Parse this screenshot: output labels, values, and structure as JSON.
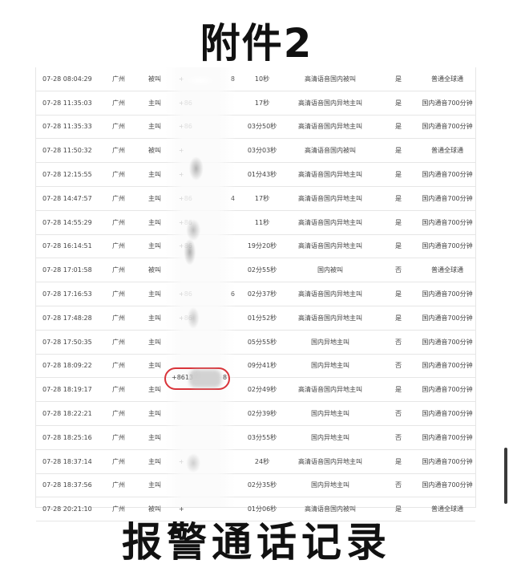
{
  "top_title": "附件2",
  "bottom_title": "报警通话记录",
  "records": [
    {
      "time": "07-28 08:04:29",
      "city": "广州",
      "direction": "被叫",
      "number": "+",
      "tail": "8",
      "duration": "10秒",
      "call_type": "高清语音国内被叫",
      "roaming": "是",
      "package": "普通全球通"
    },
    {
      "time": "07-28 11:35:03",
      "city": "广州",
      "direction": "主叫",
      "number": "+86",
      "tail": "",
      "duration": "17秒",
      "call_type": "高清语音国内异地主叫",
      "roaming": "是",
      "package": "国内通音700分钟"
    },
    {
      "time": "07-28 11:35:33",
      "city": "广州",
      "direction": "主叫",
      "number": "+86",
      "tail": "",
      "duration": "03分50秒",
      "call_type": "高清语音国内异地主叫",
      "roaming": "是",
      "package": "国内通音700分钟"
    },
    {
      "time": "07-28 11:50:32",
      "city": "广州",
      "direction": "被叫",
      "number": "+",
      "tail": "",
      "duration": "03分03秒",
      "call_type": "高清语音国内被叫",
      "roaming": "是",
      "package": "普通全球通"
    },
    {
      "time": "07-28 12:15:55",
      "city": "广州",
      "direction": "主叫",
      "number": "+",
      "tail": "",
      "duration": "01分43秒",
      "call_type": "高清语音国内异地主叫",
      "roaming": "是",
      "package": "国内通音700分钟"
    },
    {
      "time": "07-28 14:47:57",
      "city": "广州",
      "direction": "主叫",
      "number": "+86",
      "tail": "4",
      "duration": "17秒",
      "call_type": "高清语音国内异地主叫",
      "roaming": "是",
      "package": "国内通音700分钟"
    },
    {
      "time": "07-28 14:55:29",
      "city": "广州",
      "direction": "主叫",
      "number": "+86",
      "tail": "",
      "duration": "11秒",
      "call_type": "高清语音国内异地主叫",
      "roaming": "是",
      "package": "国内通音700分钟"
    },
    {
      "time": "07-28 16:14:51",
      "city": "广州",
      "direction": "主叫",
      "number": "+86",
      "tail": "",
      "duration": "19分20秒",
      "call_type": "高清语音国内异地主叫",
      "roaming": "是",
      "package": "国内通音700分钟"
    },
    {
      "time": "07-28 17:01:58",
      "city": "广州",
      "direction": "被叫",
      "number": "",
      "tail": "",
      "duration": "02分55秒",
      "call_type": "国内被叫",
      "roaming": "否",
      "package": "普通全球通"
    },
    {
      "time": "07-28 17:16:53",
      "city": "广州",
      "direction": "主叫",
      "number": "+86",
      "tail": "6",
      "duration": "02分37秒",
      "call_type": "高清语音国内异地主叫",
      "roaming": "是",
      "package": "国内通音700分钟"
    },
    {
      "time": "07-28 17:48:28",
      "city": "广州",
      "direction": "主叫",
      "number": "+86",
      "tail": "",
      "duration": "01分52秒",
      "call_type": "高清语音国内异地主叫",
      "roaming": "是",
      "package": "国内通音700分钟"
    },
    {
      "time": "07-28 17:50:35",
      "city": "广州",
      "direction": "主叫",
      "number": "",
      "tail": "",
      "duration": "05分55秒",
      "call_type": "国内异地主叫",
      "roaming": "否",
      "package": "国内通音700分钟"
    },
    {
      "time": "07-28 18:09:22",
      "city": "广州",
      "direction": "主叫",
      "number": "",
      "tail": "",
      "duration": "09分41秒",
      "call_type": "国内异地主叫",
      "roaming": "否",
      "package": "国内通音700分钟"
    },
    {
      "time": "07-28 18:19:17",
      "city": "广州",
      "direction": "主叫",
      "number": "",
      "tail": "",
      "duration": "02分49秒",
      "call_type": "高清语音国内异地主叫",
      "roaming": "是",
      "package": "国内通音700分钟"
    },
    {
      "time": "07-28 18:22:21",
      "city": "广州",
      "direction": "主叫",
      "number": "",
      "tail": "",
      "duration": "02分39秒",
      "call_type": "国内异地主叫",
      "roaming": "否",
      "package": "国内通音700分钟"
    },
    {
      "time": "07-28 18:25:16",
      "city": "广州",
      "direction": "主叫",
      "number": "",
      "tail": "",
      "duration": "03分55秒",
      "call_type": "国内异地主叫",
      "roaming": "否",
      "package": "国内通音700分钟"
    },
    {
      "time": "07-28 18:37:14",
      "city": "广州",
      "direction": "主叫",
      "number": "+",
      "tail": "",
      "duration": "24秒",
      "call_type": "高清语音国内异地主叫",
      "roaming": "是",
      "package": "国内通音700分钟"
    },
    {
      "time": "07-28 18:37:56",
      "city": "广州",
      "direction": "主叫",
      "number": "",
      "tail": "",
      "duration": "02分35秒",
      "call_type": "国内异地主叫",
      "roaming": "否",
      "package": "国内通音700分钟"
    },
    {
      "time": "07-28 20:21:10",
      "city": "广州",
      "direction": "被叫",
      "number": "+",
      "tail": "",
      "duration": "01分06秒",
      "call_type": "高清语音国内被叫",
      "roaming": "是",
      "package": "普通全球通"
    }
  ],
  "highlighted_number": {
    "prefix": "+8613",
    "suffix": "8"
  }
}
